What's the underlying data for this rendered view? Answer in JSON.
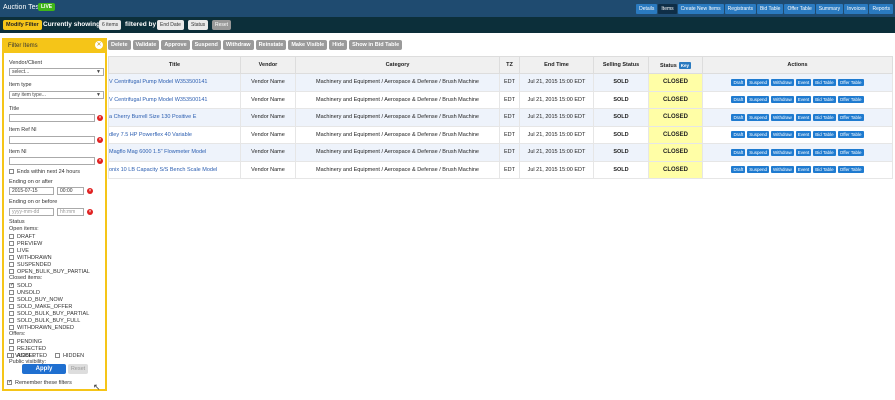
{
  "app": {
    "title": "Auction Test",
    "live_badge": "LIVE"
  },
  "topnav": [
    "Details",
    "Items",
    "Create New Items",
    "Registrants",
    "Bid Table",
    "Offer Table",
    "Summary",
    "Invoices",
    "Reports"
  ],
  "filterbar": {
    "modify": "Modify Filter",
    "showing": "Currently showing",
    "count": "6 items",
    "filtered_by": "filtered by",
    "chip_end": "End Date",
    "chip_status": "Status",
    "chip_reset": "Reset"
  },
  "toolbar": [
    "Delete",
    "Validate",
    "Approve",
    "Suspend",
    "Withdraw",
    "Reinstate",
    "Make Visible",
    "Hide",
    "Show in Bid Table"
  ],
  "table": {
    "headers": {
      "title": "Title",
      "vendor": "Vendor",
      "category": "Category",
      "tz": "TZ",
      "end": "End Time",
      "selling": "Selling Status",
      "status": "Status",
      "key": "Key",
      "actions": "Actions"
    },
    "action_labels": [
      "Draft",
      "Suspend",
      "Withdraw",
      "Event",
      "Bid Table",
      "Offer Table"
    ],
    "rows": [
      {
        "title": "V Centrifugal Pump Model W353500141",
        "vendor": "Vendor Name",
        "category": "Machinery and Equipment / Aerospace & Defense / Brush Machine",
        "tz": "EDT",
        "end": "Jul 21, 2015 15:00 EDT",
        "selling": "SOLD",
        "status": "CLOSED"
      },
      {
        "title": "V Centrifugal Pump Model W353500141",
        "vendor": "Vendor Name",
        "category": "Machinery and Equipment / Aerospace & Defense / Brush Machine",
        "tz": "EDT",
        "end": "Jul 21, 2015 15:00 EDT",
        "selling": "SOLD",
        "status": "CLOSED"
      },
      {
        "title": "a Cherry Burrell Size 130 Positive E",
        "vendor": "Vendor Name",
        "category": "Machinery and Equipment / Aerospace & Defense / Brush Machine",
        "tz": "EDT",
        "end": "Jul 21, 2015 15:00 EDT",
        "selling": "SOLD",
        "status": "CLOSED"
      },
      {
        "title": "dley 7.5 HP Powerflex 40 Variable",
        "vendor": "Vendor Name",
        "category": "Machinery and Equipment / Aerospace & Defense / Brush Machine",
        "tz": "EDT",
        "end": "Jul 21, 2015 15:00 EDT",
        "selling": "SOLD",
        "status": "CLOSED"
      },
      {
        "title": "Magflo Mag 6000 1.5\" Flowmeter Model",
        "vendor": "Vendor Name",
        "category": "Machinery and Equipment / Aerospace & Defense / Brush Machine",
        "tz": "EDT",
        "end": "Jul 21, 2015 15:00 EDT",
        "selling": "SOLD",
        "status": "CLOSED"
      },
      {
        "title": "onix 10 LB Capacity S/S Bench Scale Model",
        "vendor": "Vendor Name",
        "category": "Machinery and Equipment / Aerospace & Defense / Brush Machine",
        "tz": "EDT",
        "end": "Jul 21, 2015 15:00 EDT",
        "selling": "SOLD",
        "status": "CLOSED"
      }
    ]
  },
  "panel": {
    "header": "Filter Items",
    "vendor_label": "Vendor/Client",
    "vendor_value": "select...",
    "item_type_label": "Item type",
    "item_type_value": "any item type...",
    "title_label": "Title",
    "ref_label": "Item Ref Nl",
    "nl_label": "Item Nl",
    "ends_24": "Ends within next 24 hours",
    "after_label": "Ending on or after",
    "after_date": "2015-07-15",
    "after_time": "00:00",
    "before_label": "Ending on or before",
    "before_date_ph": "yyyy-mm-dd",
    "before_time_ph": "hh:mm",
    "status_label": "Status",
    "open_label": "Open items:",
    "open_items": [
      "DRAFT",
      "PREVIEW",
      "LIVE",
      "WITHDRAWN",
      "SUSPENDED",
      "OPEN_BULK_BUY_PARTIAL"
    ],
    "closed_label": "Closed items:",
    "closed_items": [
      "SOLD",
      "UNSOLD",
      "SOLD_BUY_NOW",
      "SOLD_MAKE_OFFER",
      "SOLD_BULK_BUY_PARTIAL",
      "SOLD_BULK_BUY_FULL",
      "WITHDRAWN_ENDED"
    ],
    "offers_label": "Offers:",
    "offer_items": [
      "PENDING",
      "REJECTED",
      "ACCEPTED"
    ],
    "visibility_label": "Public visibility:",
    "visible": "VISIBLE",
    "hidden": "HIDDEN",
    "apply": "Apply",
    "reset": "Reset",
    "remember": "Remember these filters"
  },
  "colors": {
    "topbar": "#1f4b70",
    "filterbar": "#0c2f3a",
    "accent": "#f5c518",
    "button_blue": "#1f7bd0",
    "closed_bg": "#fffea6"
  }
}
